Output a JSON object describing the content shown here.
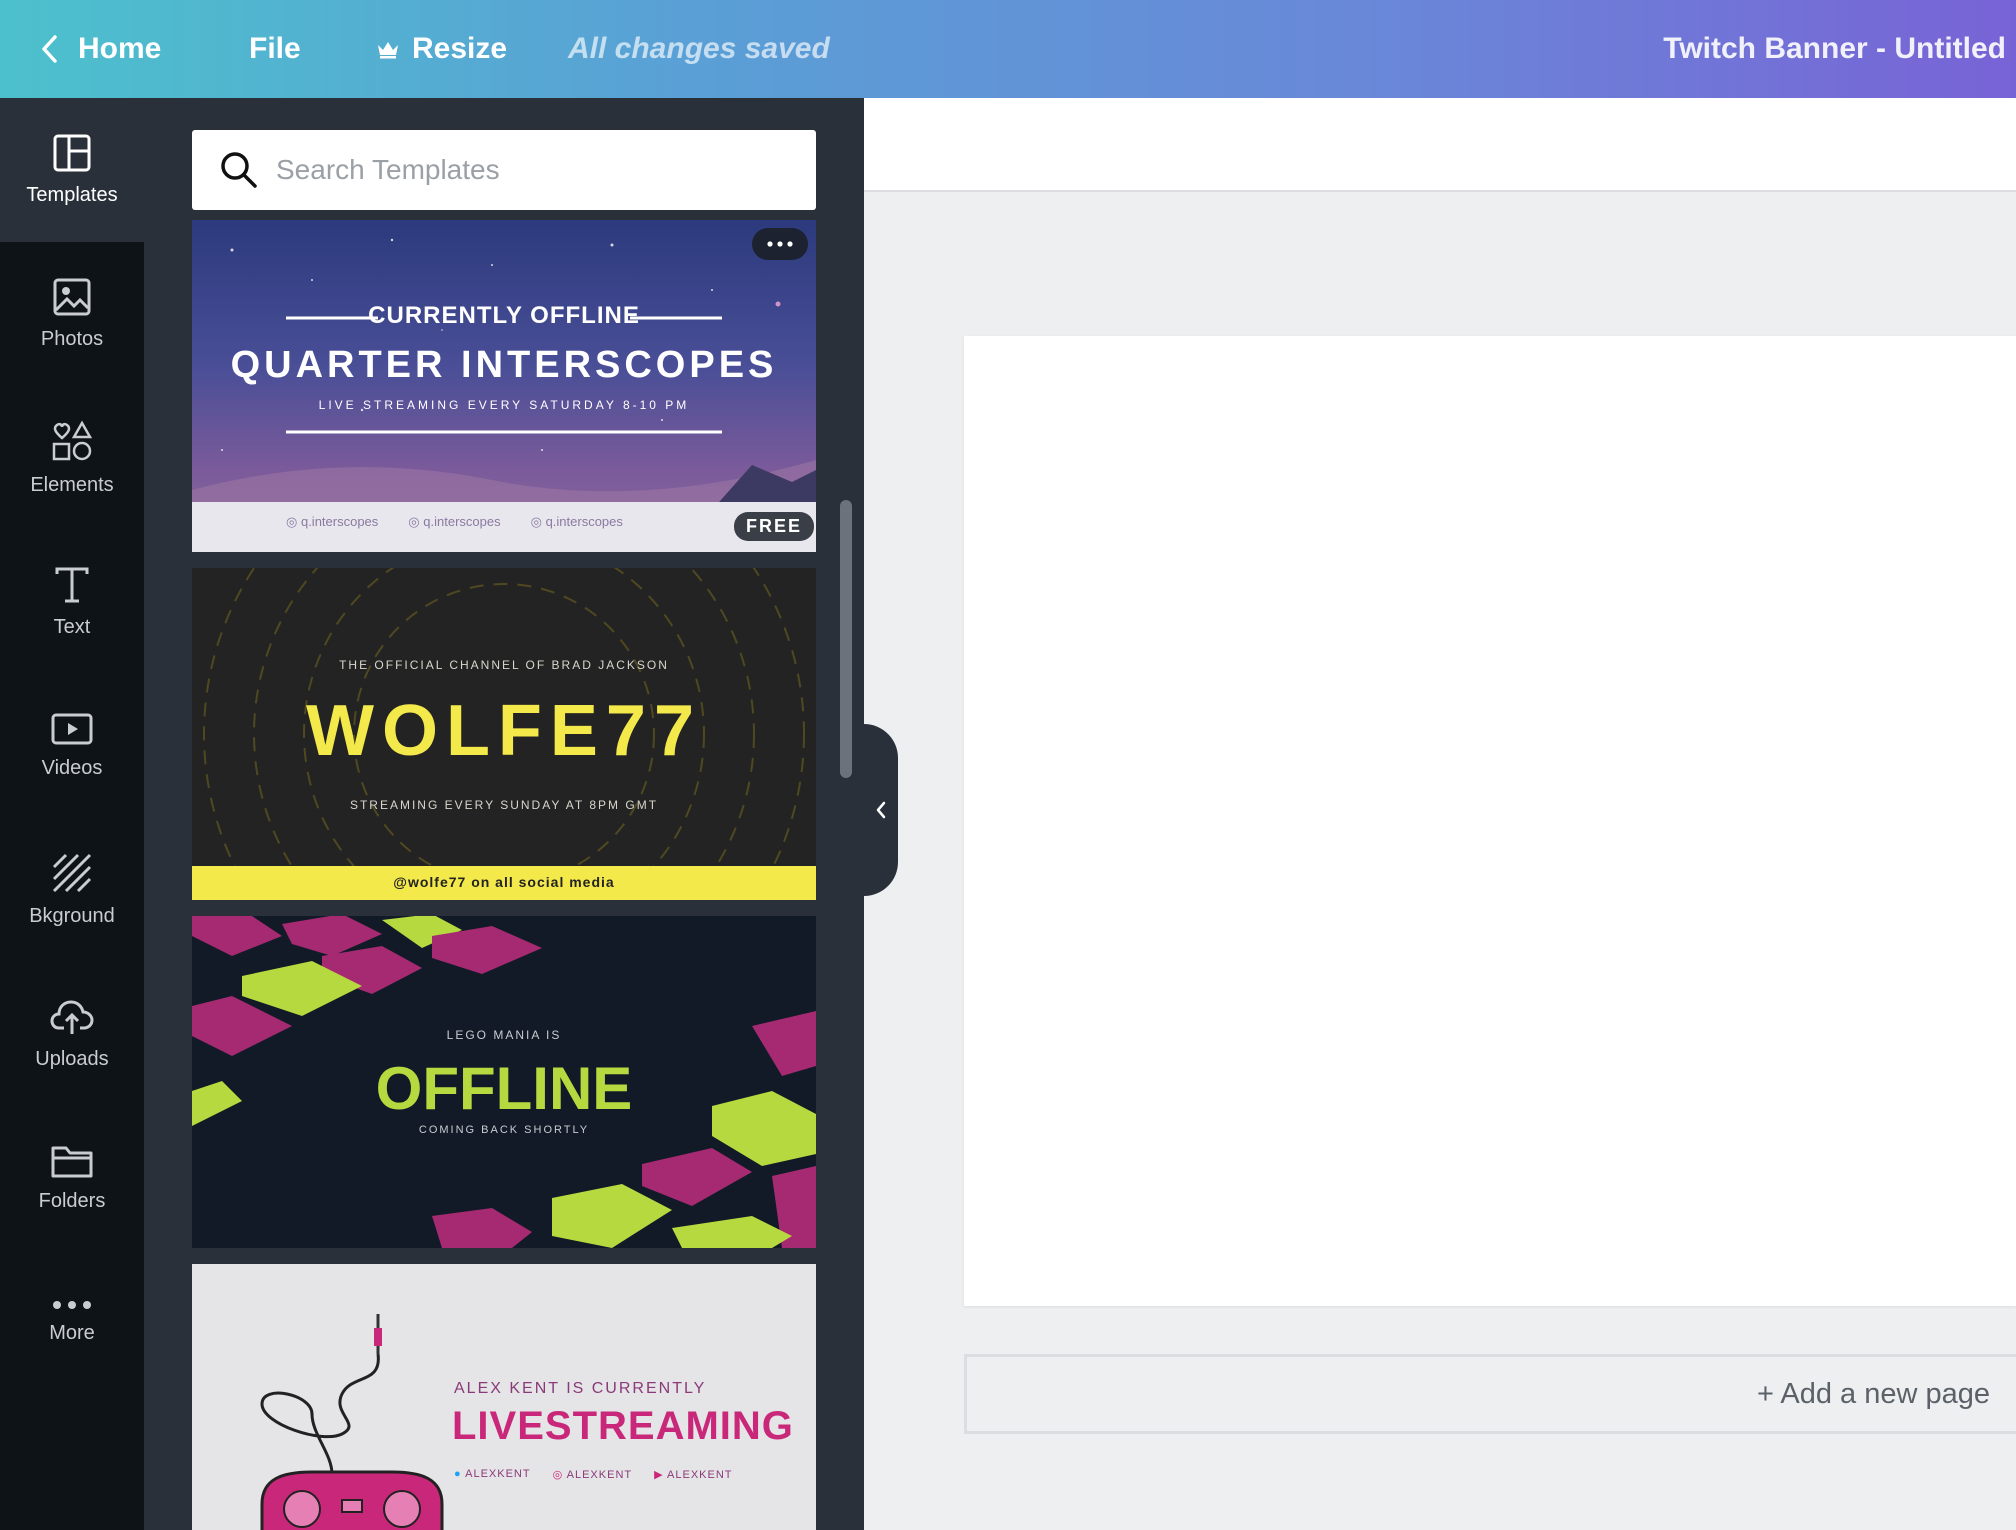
{
  "topbar": {
    "home_label": "Home",
    "file_label": "File",
    "resize_label": "Resize",
    "saved_status": "All changes saved",
    "doc_title": "Twitch Banner - Untitled"
  },
  "rail": {
    "items": [
      {
        "label": "Templates",
        "icon": "templates-icon"
      },
      {
        "label": "Photos",
        "icon": "photos-icon"
      },
      {
        "label": "Elements",
        "icon": "elements-icon"
      },
      {
        "label": "Text",
        "icon": "text-icon"
      },
      {
        "label": "Videos",
        "icon": "videos-icon"
      },
      {
        "label": "Bkground",
        "icon": "background-icon"
      },
      {
        "label": "Uploads",
        "icon": "upload-icon"
      },
      {
        "label": "Folders",
        "icon": "folder-icon"
      },
      {
        "label": "More",
        "icon": "more-icon"
      }
    ]
  },
  "search": {
    "placeholder": "Search Templates"
  },
  "templates": [
    {
      "headline": "CURRENTLY OFFLINE",
      "title": "QUARTER INTERSCOPES",
      "subtitle": "LIVE STREAMING EVERY SATURDAY 8-10 PM",
      "socials": [
        "q.interscopes",
        "q.interscopes",
        "q.interscopes"
      ],
      "badge": "FREE"
    },
    {
      "headline": "THE OFFICIAL CHANNEL OF BRAD JACKSON",
      "title": "WOLFE77",
      "subtitle": "STREAMING EVERY SUNDAY AT 8PM GMT",
      "footer": "@wolfe77 on all social media"
    },
    {
      "headline": "LEGO MANIA IS",
      "title": "OFFLINE",
      "subtitle": "COMING BACK SHORTLY"
    },
    {
      "headline": "ALEX KENT IS CURRENTLY",
      "title": "LIVESTREAMING",
      "socials": [
        "ALEXKENT",
        "ALEXKENT",
        "ALEXKENT"
      ]
    }
  ],
  "editor": {
    "add_page_label": "+ Add a new page"
  },
  "colors": {
    "accent_yellow": "#f4e94a",
    "lego_green": "#b6d940",
    "lego_magenta": "#a52a72",
    "livestream_pink": "#c9287a"
  }
}
